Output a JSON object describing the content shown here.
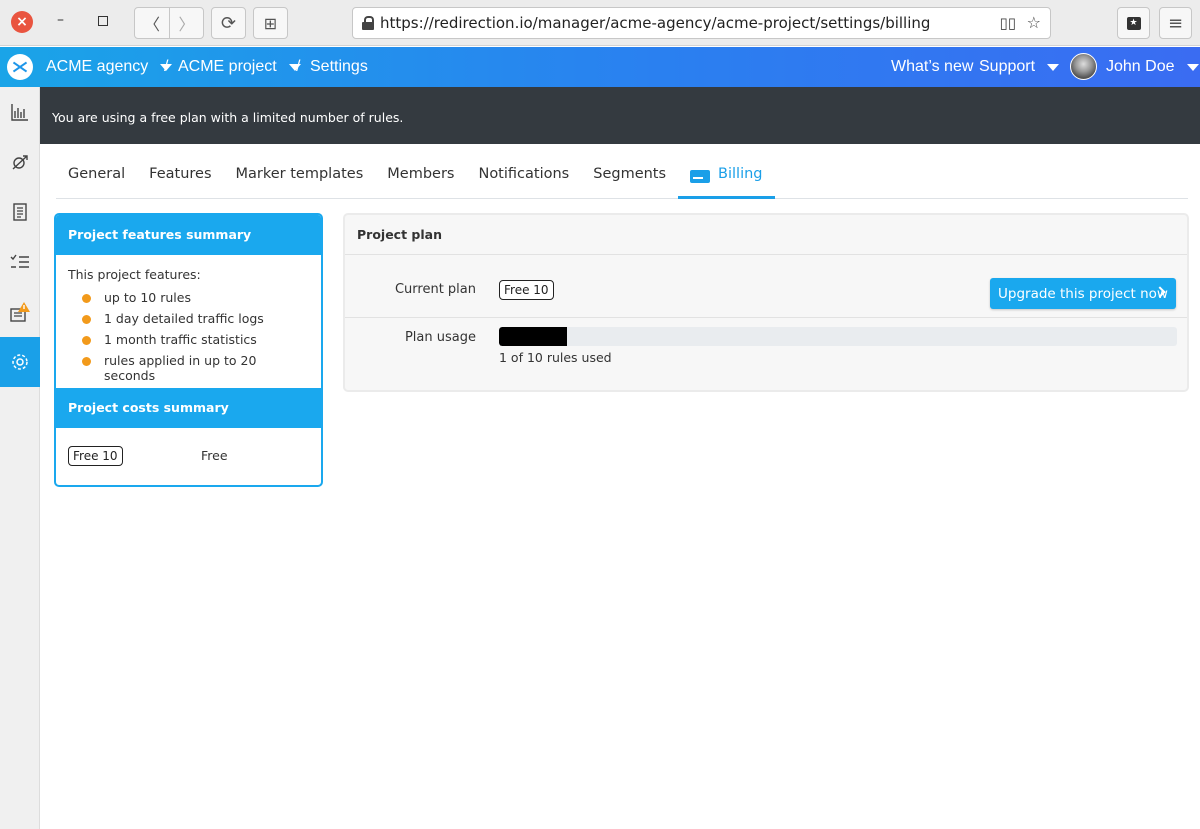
{
  "browser": {
    "close_glyph": "×",
    "min_glyph": "–",
    "back_glyph": "〈",
    "forward_glyph": "〉",
    "reload_glyph": "⟳",
    "newtab_glyph": "⊞",
    "url": "https://redirection.io/manager/acme-agency/acme-project/settings/billing",
    "menu_glyph": "≡"
  },
  "header": {
    "organization": "ACME agency",
    "project": "ACME project",
    "page": "Settings",
    "separator": "/",
    "whats_new": "What’s new",
    "support": "Support",
    "user": "John Doe"
  },
  "sidebar": {
    "items": [
      "analytics-icon",
      "traffic-logs-icon",
      "rules-icon",
      "checklist-icon",
      "notifications-icon",
      "settings-icon"
    ]
  },
  "notice": "You are using a free plan with a limited number of rules.",
  "tabs": [
    "General",
    "Features",
    "Marker templates",
    "Members",
    "Notifications",
    "Segments",
    "Billing"
  ],
  "active_tab": "Billing",
  "features_summary": {
    "title": "Project features summary",
    "intro": "This project features:",
    "items": [
      "up to 10 rules",
      "1 day detailed traffic logs",
      "1 month traffic statistics",
      "rules applied in up to 20 seconds"
    ]
  },
  "costs_summary": {
    "title": "Project costs summary",
    "plan": "Free 10",
    "cost": "Free"
  },
  "project_plan": {
    "title": "Project plan",
    "current_plan_label": "Current plan",
    "current_plan": "Free 10",
    "upgrade_label": "Upgrade this project now",
    "plan_usage_label": "Plan usage",
    "usage_text": "1 of 10 rules used",
    "usage_fraction": 0.1
  },
  "colors": {
    "accent": "#1aa8ee",
    "notice_bg": "#343a40",
    "bullet": "#f29a1b"
  }
}
